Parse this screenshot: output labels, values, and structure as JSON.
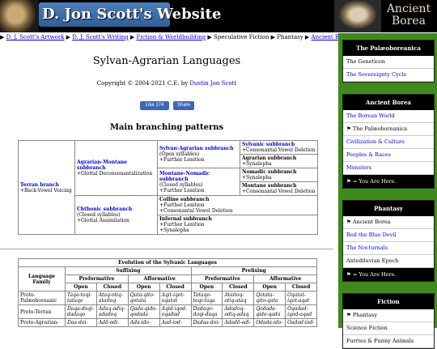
{
  "header": {
    "site_title": "D. Jon Scott's Website",
    "right_title_line1": "Ancient",
    "right_title_line2": "Borea"
  },
  "breadcrumb": [
    {
      "text": "D. J. Scott's Artwork",
      "link": true
    },
    {
      "text": "D. J. Scott's Writing",
      "link": true
    },
    {
      "text": "Fiction & Worldbuilding",
      "link": true
    },
    {
      "text": "Speculative Fiction",
      "link": false
    },
    {
      "text": "Phantasy",
      "link": false
    },
    {
      "text": "Ancient Borea",
      "link": true
    }
  ],
  "page": {
    "title": "Sylvan-Agrarian Languages",
    "copyright_prefix": "Copyright © 2004-2021 C.E. by",
    "author": "Dustin Jon Scott",
    "fb_like": "Like 174",
    "fb_share": "Share",
    "section_heading": "Main branching patterns"
  },
  "tree": {
    "terran": {
      "name": "Terran branch",
      "desc": "+Back-Vowel Voicing"
    },
    "agrarian_montane": {
      "name": "Agrarian-Montane subbranch",
      "desc": "+Glottal Deconsonantalization"
    },
    "chthonic": {
      "name": "Chthonic subbranch",
      "desc1": "(Closed syllables)",
      "desc2": "+Glottal Assimilation"
    },
    "sylvan_agrarian": {
      "name": "Sylvan-Agrarian subbranch",
      "desc1": "(Open syllables)",
      "desc2": "+Further Lenition"
    },
    "montane_nomadic": {
      "name": "Montane-Nomadic subbranch",
      "desc1": "(Closed syllables)",
      "desc2": "+Further Lenition"
    },
    "colline": {
      "name": "Colline subbranch",
      "desc1": "+Further Lenition",
      "desc2": "+Consonantal Vowel Deletion"
    },
    "infernal": {
      "name": "Infernal subbranch",
      "desc1": "+Further Lenition",
      "desc2": "+Synalepha"
    },
    "sylvanic": {
      "name": "Sylvanic subbranch",
      "desc": "+Consonantal Vowel Deletion"
    },
    "agrarian": {
      "name": "Agrarian subbranch",
      "desc": "+Synalepha"
    },
    "nomadic": {
      "name": "Nomadic subbranch",
      "desc": "+Synalepha"
    },
    "montane": {
      "name": "Montane subbranch",
      "desc": "+Consonantal Vowel Deletion"
    }
  },
  "evolution": {
    "title": "Evolution of the Sylvanic Languages",
    "language_family": "Language Family",
    "suffixing": "Suffixing",
    "prefixing": "Prefixing",
    "preformative": "Preformative",
    "afformative": "Afformative",
    "open": "Open",
    "closed": "Closed",
    "rows": [
      {
        "family": "Proto-Palæoboreanic",
        "cells": [
          "Taqa-toqi-tataqo",
          "Ataq-otiq-ataitoq",
          "Qata-qito-qotata",
          "Aqit-iqot-oqatat",
          "Tataqo-toqi-taqa",
          "Ataitoq-otiq-ataq",
          "Qotata-qito-qata",
          "Oqatat-iqot-aqat"
        ]
      },
      {
        "family": "Proto-Terran",
        "cells": [
          "Daqa-doqi-dadaqo",
          "Adaq-odiq-adadoq",
          "Qada-qido-qodada",
          "Aqid-iqod-oqadad",
          "Dadaqo-doqi-daqa",
          "Adadoq-odiq-adaq",
          "Qodada-qido-qada",
          "Oqadad-iqod-aqad"
        ]
      },
      {
        "family": "Proto-Agrarian-",
        "cells": [
          "Daa-doi-",
          "Adã-odi-",
          "Ada-ido-",
          "Aad-iod-",
          "Dadaa-doi-",
          "Adadõ-odi-",
          "Odada-ido-",
          "Oadad-iod-"
        ]
      }
    ]
  },
  "sidebar": {
    "boxes": [
      {
        "head": "The Palæoboreanica",
        "items": [
          {
            "label": "The Geneticon",
            "kind": "plain"
          },
          {
            "label": "The Sovereignty Cycle",
            "kind": "link"
          }
        ],
        "foot": null
      },
      {
        "head": "Ancient Borea",
        "items": [
          {
            "label": "The Borean World",
            "kind": "link"
          },
          {
            "label": "⚑ The Palæoboreanica",
            "kind": "current"
          },
          {
            "label": "Civilization & Culture",
            "kind": "link"
          },
          {
            "label": "Peoples & Races",
            "kind": "link"
          },
          {
            "label": "Monsters",
            "kind": "link"
          }
        ],
        "foot": "⚑ = You Are Here."
      },
      {
        "head": "Phantasy",
        "items": [
          {
            "label": "⚑ Ancient Borea",
            "kind": "current"
          },
          {
            "label": "Red the Blue Devil",
            "kind": "link"
          },
          {
            "label": "The Nocturnals",
            "kind": "link"
          },
          {
            "label": "Antediluvian Epoch",
            "kind": "plain"
          }
        ],
        "foot": "⚑ = You Are Here."
      },
      {
        "head": "Fiction",
        "items": [
          {
            "label": "⚑ Phantasy",
            "kind": "current"
          },
          {
            "label": "Science Fiction",
            "kind": "plain"
          },
          {
            "label": "Furries & Funny Animals",
            "kind": "plain"
          }
        ],
        "foot": null
      }
    ]
  }
}
